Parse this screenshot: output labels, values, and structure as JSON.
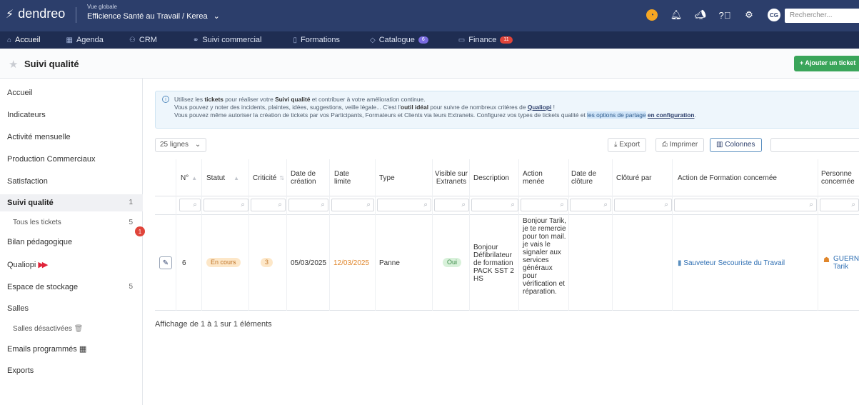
{
  "app": {
    "logo": "dendreo",
    "org_small": "Vue globale",
    "org_name": "Efficience Santé au Travail / Kerea",
    "avatar": "CG",
    "search_placeholder": "Rechercher..."
  },
  "nav": {
    "items": [
      {
        "label": "Accueil",
        "icon": "home-icon"
      },
      {
        "label": "Agenda",
        "icon": "calendar-icon"
      },
      {
        "label": "CRM",
        "icon": "users-icon"
      },
      {
        "label": "Suivi commercial",
        "icon": "handshake-icon"
      },
      {
        "label": "Formations",
        "icon": "book-icon"
      },
      {
        "label": "Catalogue",
        "icon": "tag-icon",
        "badge": "6"
      },
      {
        "label": "Finance",
        "icon": "money-icon",
        "badge": "11"
      }
    ]
  },
  "page": {
    "title": "Suivi qualité",
    "add_button": "+ Ajouter un ticket"
  },
  "sidebar": {
    "items": [
      {
        "label": "Accueil"
      },
      {
        "label": "Indicateurs"
      },
      {
        "label": "Activité mensuelle"
      },
      {
        "label": "Production Commerciaux"
      },
      {
        "label": "Satisfaction"
      },
      {
        "label": "Suivi qualité",
        "count": "1"
      },
      {
        "label": "Tous les tickets",
        "count": "5"
      },
      {
        "label": "Bilan pédagogique"
      },
      {
        "label": "Qualiopi"
      },
      {
        "label": "Espace de stockage",
        "count": "5"
      },
      {
        "label": "Salles"
      },
      {
        "label": "Salles désactivées"
      },
      {
        "label": "Emails programmés"
      },
      {
        "label": "Exports"
      }
    ],
    "red_badge": "1"
  },
  "info": {
    "line1_a": "Utilisez les ",
    "line1_b": "tickets",
    "line1_c": " pour réaliser votre ",
    "line1_d": "Suivi qualité",
    "line1_e": " et contribuer à votre amélioration continue.",
    "line2_a": "Vous pouvez y noter des incidents, plaintes, idées, suggestions, veille légale... C'est l'",
    "line2_b": "outil idéal",
    "line2_c": " pour suivre de nombreux critères de ",
    "line2_d": "Qualiopi",
    "line2_e": " !",
    "line3_a": "Vous pouvez même autoriser la création de tickets par vos Participants, Formateurs et Clients via leurs Extranets. Configurez vos types de tickets qualité et ",
    "line3_b": "les options de partage",
    "line3_c": " ",
    "line3_d": "en configuration",
    "line3_e": "."
  },
  "toolbar": {
    "lines": "25 lignes",
    "export": "Export",
    "print": "Imprimer",
    "columns": "Colonnes"
  },
  "table": {
    "headers": {
      "num": "N°",
      "statut": "Statut",
      "criticite": "Criticité",
      "date_creation": "Date de création",
      "date_limite": "Date limite",
      "type": "Type",
      "visible": "Visible sur Extranets",
      "description": "Description",
      "action": "Action menée",
      "date_cloture": "Date de clôture",
      "cloture_par": "Clôturé par",
      "action_formation": "Action de Formation concernée",
      "personne": "Personne concernée"
    },
    "row": {
      "num": "6",
      "statut": "En cours",
      "criticite": "3",
      "date_creation": "05/03/2025",
      "date_limite": "12/03/2025",
      "type": "Panne",
      "visible": "Oui",
      "description": "Bonjour Défibrilateur de formation PACK SST 2 HS",
      "action": "Bonjour Tarik, je te remercie pour ton mail. je vais le signaler aux services généraux pour vérification et réparation.",
      "date_cloture": "",
      "cloture_par": "",
      "action_formation": "Sauveteur Secouriste du Travail",
      "personne": "GUERNIC Tarik"
    }
  },
  "footer": {
    "info": "Affichage de 1 à 1 sur 1 éléments"
  }
}
